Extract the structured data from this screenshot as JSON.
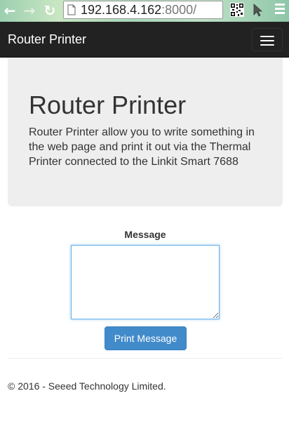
{
  "browser": {
    "url_host": "192.168.4.162",
    "url_port": ":8000/",
    "translate_glyph": "文A",
    "star_glyph": "☆"
  },
  "navbar": {
    "brand": "Router Printer"
  },
  "jumbotron": {
    "title": "Router Printer",
    "description": "Router Printer allow you to write something in the web page and print it out via the Thermal Printer connected to the Linkit Smart 7688"
  },
  "form": {
    "message_label": "Message",
    "message_value": "",
    "print_button": "Print Message"
  },
  "footer": {
    "copyright": "© 2016 - Seeed Technology Limited."
  },
  "colors": {
    "navbar_bg": "#222222",
    "jumbotron_bg": "#eeeeee",
    "primary_button": "#428bca",
    "focus_border": "#66afe9"
  }
}
